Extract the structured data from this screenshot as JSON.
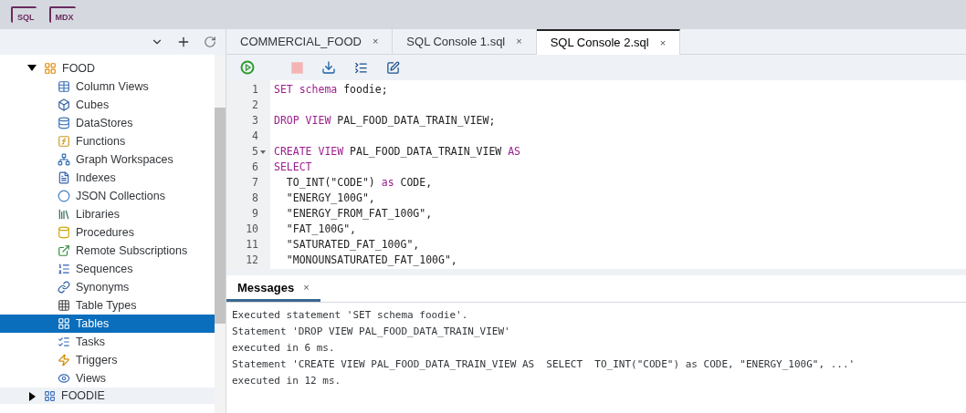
{
  "top_toolbar": [
    {
      "label": "SQL"
    },
    {
      "label": "MDX"
    }
  ],
  "tree": {
    "label": "FOOD",
    "expanded": true,
    "children": [
      {
        "label": "Column Views",
        "kind": "columnview",
        "selected": false
      },
      {
        "label": "Cubes",
        "kind": "cube",
        "selected": false
      },
      {
        "label": "DataStores",
        "kind": "datastore",
        "selected": false
      },
      {
        "label": "Functions",
        "kind": "function",
        "selected": false
      },
      {
        "label": "Graph Workspaces",
        "kind": "graph",
        "selected": false
      },
      {
        "label": "Indexes",
        "kind": "index",
        "selected": false
      },
      {
        "label": "JSON Collections",
        "kind": "json",
        "selected": false
      },
      {
        "label": "Libraries",
        "kind": "library",
        "selected": false
      },
      {
        "label": "Procedures",
        "kind": "procedure",
        "selected": false
      },
      {
        "label": "Remote Subscriptions",
        "kind": "remote",
        "selected": false
      },
      {
        "label": "Sequences",
        "kind": "sequence",
        "selected": false
      },
      {
        "label": "Synonyms",
        "kind": "synonym",
        "selected": false
      },
      {
        "label": "Table Types",
        "kind": "tabletype",
        "selected": false
      },
      {
        "label": "Tables",
        "kind": "table",
        "selected": true
      },
      {
        "label": "Tasks",
        "kind": "task",
        "selected": false
      },
      {
        "label": "Triggers",
        "kind": "trigger",
        "selected": false
      },
      {
        "label": "Views",
        "kind": "view",
        "selected": false
      }
    ]
  },
  "tree_next": {
    "label": "FOODIE",
    "expanded": false
  },
  "tabs": [
    {
      "label": "COMMERCIAL_FOOD",
      "close": "×",
      "selected": false
    },
    {
      "label": "SQL Console 1.sql",
      "close": "×",
      "selected": false
    },
    {
      "label": "SQL Console 2.sql",
      "close": "×",
      "selected": true
    }
  ],
  "code_lines": [
    {
      "number": "1",
      "fold": false,
      "tokens": [
        {
          "kind": "keyword",
          "text": "SET schema"
        },
        {
          "kind": "plain",
          "text": " foodie;"
        }
      ]
    },
    {
      "number": "2",
      "fold": false
    },
    {
      "number": "3",
      "fold": false,
      "tokens": [
        {
          "kind": "keyword",
          "text": "DROP VIEW"
        },
        {
          "kind": "plain",
          "text": " PAL_FOOD_DATA_TRAIN_VIEW;"
        }
      ]
    },
    {
      "number": "4",
      "fold": false
    },
    {
      "number": "5",
      "fold": true,
      "tokens": [
        {
          "kind": "keyword",
          "text": "CREATE VIEW"
        },
        {
          "kind": "plain",
          "text": " PAL_FOOD_DATA_TRAIN_VIEW "
        },
        {
          "kind": "keyword",
          "text": "AS"
        }
      ]
    },
    {
      "number": "6",
      "fold": false,
      "tokens": [
        {
          "kind": "keyword",
          "text": "SELECT"
        }
      ]
    },
    {
      "number": "7",
      "fold": false,
      "tokens": [
        {
          "kind": "plain",
          "text": "  TO_INT(\"CODE\") "
        },
        {
          "kind": "keyword",
          "text": "as"
        },
        {
          "kind": "plain",
          "text": " CODE,"
        }
      ]
    },
    {
      "number": "8",
      "fold": false,
      "tokens": [
        {
          "kind": "plain",
          "text": "  \"ENERGY_100G\","
        }
      ]
    },
    {
      "number": "9",
      "fold": false,
      "tokens": [
        {
          "kind": "plain",
          "text": "  \"ENERGY_FROM_FAT_100G\","
        }
      ]
    },
    {
      "number": "10",
      "fold": false,
      "tokens": [
        {
          "kind": "plain",
          "text": "  \"FAT_100G\","
        }
      ]
    },
    {
      "number": "11",
      "fold": false,
      "tokens": [
        {
          "kind": "plain",
          "text": "  \"SATURATED_FAT_100G\","
        }
      ]
    },
    {
      "number": "12",
      "fold": false,
      "tokens": [
        {
          "kind": "plain",
          "text": "  \"MONOUNSATURATED_FAT_100G\","
        }
      ]
    }
  ],
  "messages_panel": {
    "tab": {
      "label": "Messages",
      "close": "×",
      "selected": true
    },
    "lines": [
      "Executed statement 'SET schema foodie'.",
      "Statement 'DROP VIEW PAL_FOOD_DATA_TRAIN_VIEW'",
      "executed in 6 ms.",
      "Statement 'CREATE VIEW PAL_FOOD_DATA_TRAIN_VIEW AS  SELECT  TO_INT(\"CODE\") as CODE, \"ENERGY_100G\", ...'",
      "executed in 12 ms."
    ]
  }
}
